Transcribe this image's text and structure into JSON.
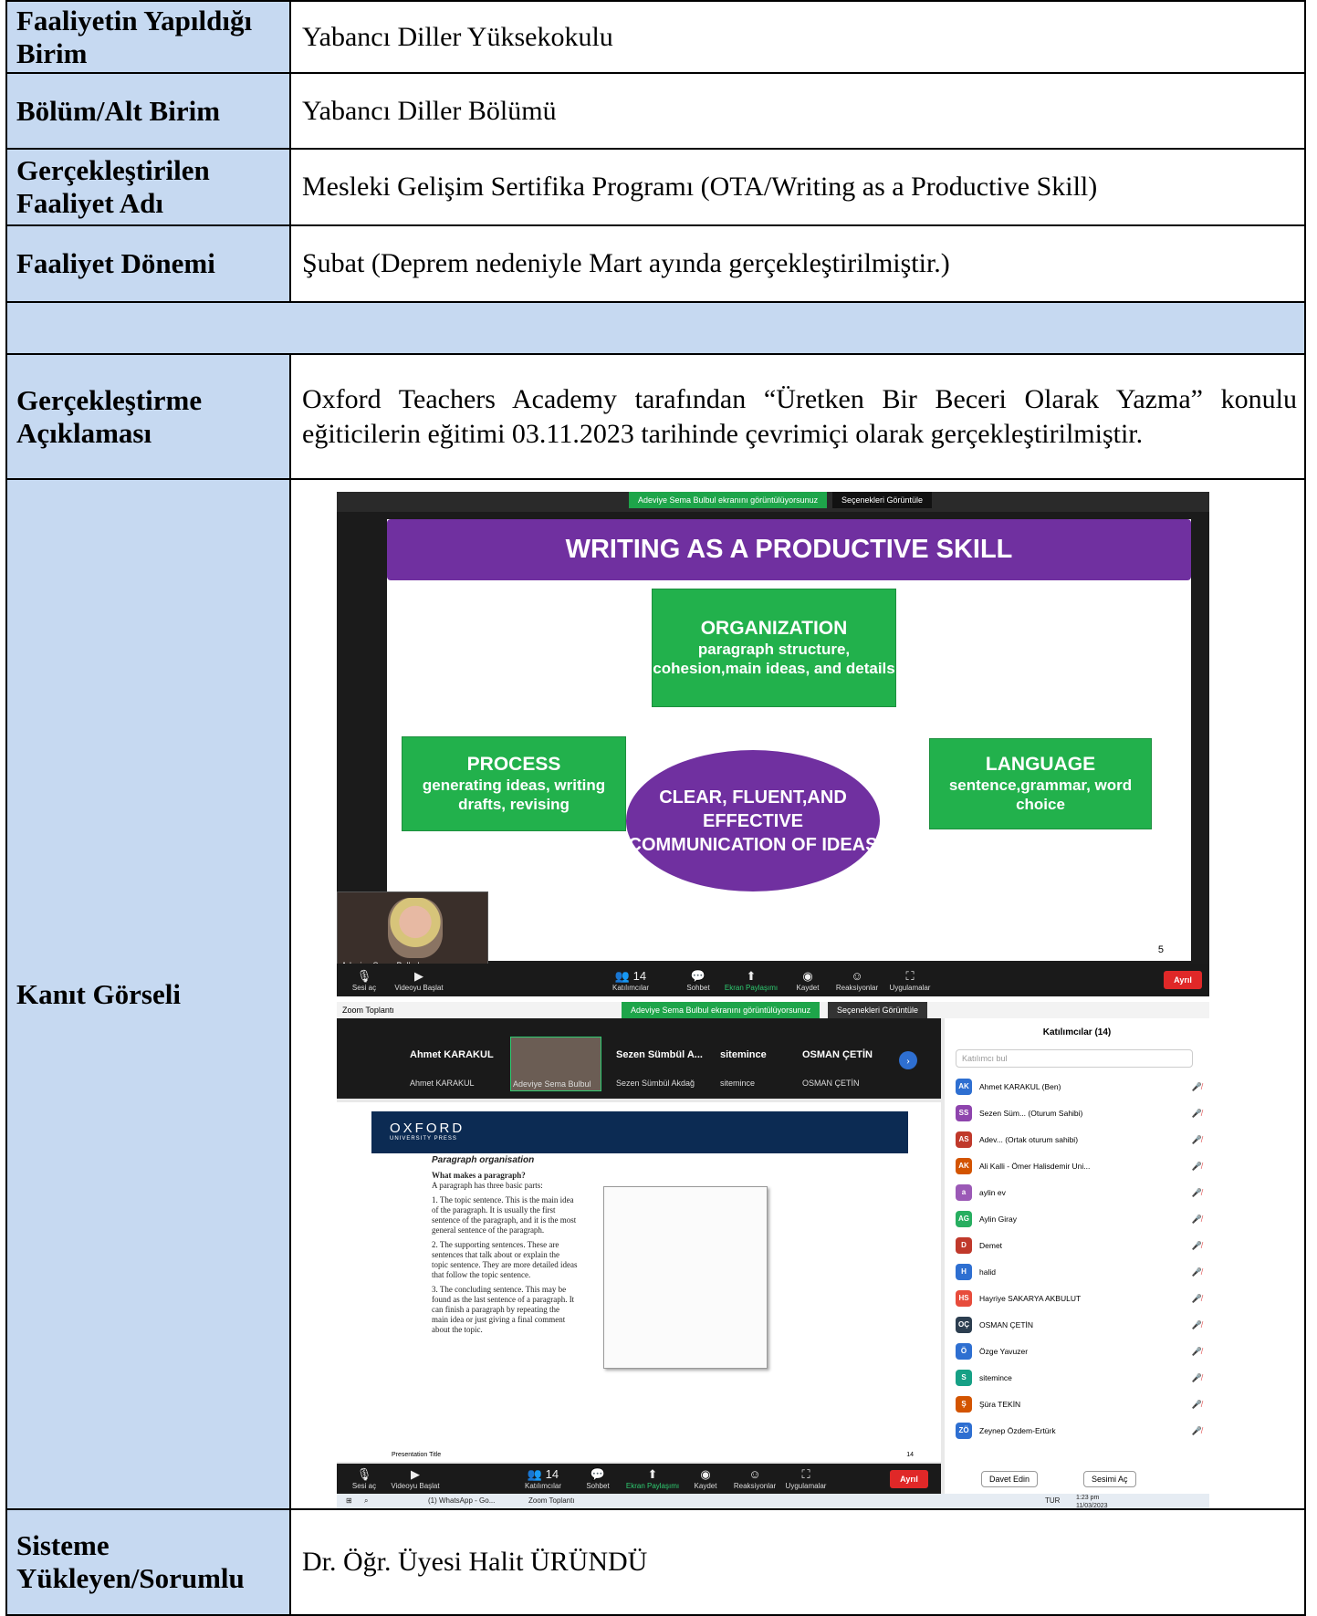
{
  "rows": {
    "birim": {
      "label": "Faaliyetin Yapıldığı Birim",
      "value": "Yabancı Diller Yüksekokulu"
    },
    "bolum": {
      "label": "Bölüm/Alt Birim",
      "value": "Yabancı Diller Bölümü"
    },
    "faaliyet_adi": {
      "label": "Gerçekleştirilen Faaliyet Adı",
      "value": "Mesleki Gelişim Sertifika Programı (OTA/Writing as a Productive Skill)"
    },
    "donem": {
      "label": "Faaliyet Dönemi",
      "value": "Şubat (Deprem nedeniyle Mart ayında gerçekleştirilmiştir.)"
    },
    "aciklama": {
      "label": "Gerçekleştirme Açıklaması",
      "value": "Oxford Teachers Academy tarafından “Üretken Bir Beceri Olarak Yazma” konulu eğiticilerin eğitimi 03.11.2023 tarihinde çevrimiçi olarak gerçekleştirilmiştir."
    },
    "kanit": {
      "label": "Kanıt Görseli"
    },
    "sorumlu": {
      "label": "Sisteme Yükleyen/Sorumlu",
      "value": "Dr. Öğr. Üyesi Halit ÜRÜNDÜ"
    }
  },
  "colors": {
    "label_bg": "#c6d9f1",
    "slide_purple": "#7030a0",
    "slide_green": "#22b14c",
    "zoom_green": "#1ea54a"
  },
  "screenshot1": {
    "share_banner": "Adeviye Sema Bulbul ekranını görüntülüyorsunuz",
    "view_options": "Seçenekleri Görüntüle",
    "slide_title": "WRITING AS A PRODUCTIVE SKILL",
    "organization": {
      "heading": "ORGANIZATION",
      "text": "paragraph structure, cohesion,main ideas, and details"
    },
    "process": {
      "heading": "PROCESS",
      "text": "generating ideas, writing drafts, revising"
    },
    "language": {
      "heading": "LANGUAGE",
      "text": "sentence,grammar, word choice"
    },
    "center": "CLEAR, FLUENT,AND EFFECTIVE COMMUNICATION OF IDEAS",
    "slide_number": "5",
    "camera_name": "Adeviye Sema Bulbul",
    "toolbar": {
      "audio": "Sesi aç",
      "video": "Videoyu Başlat",
      "participants": "Katılımcılar",
      "participants_count": "14",
      "chat": "Sohbet",
      "share": "Ekran Paylaşımı",
      "record": "Kaydet",
      "reactions": "Reaksiyonlar",
      "apps": "Uygulamalar",
      "leave": "Ayrıl"
    }
  },
  "screenshot2": {
    "window_title": "Zoom Toplantı",
    "share_banner": "Adeviye Sema Bulbul ekranını görüntülüyorsunuz",
    "view_options": "Seçenekleri Görüntüle",
    "tiles": [
      {
        "name": "Ahmet KARAKUL",
        "sub": "Ahmet KARAKUL"
      },
      {
        "name": "",
        "sub": "Adeviye Sema Bulbul"
      },
      {
        "name": "Sezen Sümbül A...",
        "sub": "Sezen Sümbül Akdağ"
      },
      {
        "name": "sitemince",
        "sub": "sitemince"
      },
      {
        "name": "OSMAN ÇETİN",
        "sub": "OSMAN ÇETİN"
      }
    ],
    "oxford": "OXFORD",
    "oxford_sub": "UNIVERSITY PRESS",
    "doc_heading": "Paragraph organisation",
    "doc_q": "What makes a paragraph?",
    "doc_intro": "A paragraph has three basic parts:",
    "doc_items": [
      "1. The topic sentence. This is the main idea of the paragraph. It is usually the first sentence of the paragraph, and it is the most general sentence of the paragraph.",
      "2. The supporting sentences. These are sentences that talk about or explain the topic sentence. They are more detailed ideas that follow the topic sentence.",
      "3. The concluding sentence. This may be found as the last sentence of a paragraph. It can finish a paragraph by repeating the main idea or just giving a final comment about the topic."
    ],
    "presentation_title": "Presentation Title",
    "page_number": "14",
    "panel": {
      "title": "Katılımcılar (14)",
      "search_placeholder": "Katılımcı bul",
      "participants": [
        {
          "initials": "AK",
          "name": "Ahmet KARAKUL (Ben)",
          "color": "#2e6fd1"
        },
        {
          "initials": "SS",
          "name": "Sezen Süm... (Oturum Sahibi)",
          "color": "#8e44ad"
        },
        {
          "initials": "AS",
          "name": "Adev... (Ortak oturum sahibi)",
          "color": "#c0392b"
        },
        {
          "initials": "AK",
          "name": "Ali Kalli - Ömer Halisdemir Uni...",
          "color": "#d35400"
        },
        {
          "initials": "a",
          "name": "aylin ev",
          "color": "#9b59b6"
        },
        {
          "initials": "AG",
          "name": "Aylin Giray",
          "color": "#27ae60"
        },
        {
          "initials": "D",
          "name": "Demet",
          "color": "#c0392b"
        },
        {
          "initials": "H",
          "name": "halid",
          "color": "#2e6fd1"
        },
        {
          "initials": "HS",
          "name": "Hayriye SAKARYA AKBULUT",
          "color": "#e74c3c"
        },
        {
          "initials": "OÇ",
          "name": "OSMAN ÇETİN",
          "color": "#2c3e50"
        },
        {
          "initials": "Ö",
          "name": "Özge Yavuzer",
          "color": "#2e6fd1"
        },
        {
          "initials": "S",
          "name": "sitemince",
          "color": "#16a085"
        },
        {
          "initials": "Ş",
          "name": "Şüra TEKİN",
          "color": "#d35400"
        },
        {
          "initials": "ZÖ",
          "name": "Zeynep Özdem-Ertürk",
          "color": "#2e6fd1"
        }
      ],
      "invite": "Davet Edin",
      "mute_all": "Sesimi Aç"
    },
    "taskbar": {
      "whatsapp": "(1) WhatsApp - Go...",
      "zoom": "Zoom Toplantı",
      "lang": "TUR",
      "time": "1:23 pm",
      "date": "11/03/2023"
    },
    "toolbar": {
      "audio": "Sesi aç",
      "video": "Videoyu Başlat",
      "participants": "Katılımcılar",
      "participants_count": "14",
      "chat": "Sohbet",
      "share": "Ekran Paylaşımı",
      "record": "Kaydet",
      "reactions": "Reaksiyonlar",
      "apps": "Uygulamalar",
      "leave": "Ayrıl"
    }
  }
}
